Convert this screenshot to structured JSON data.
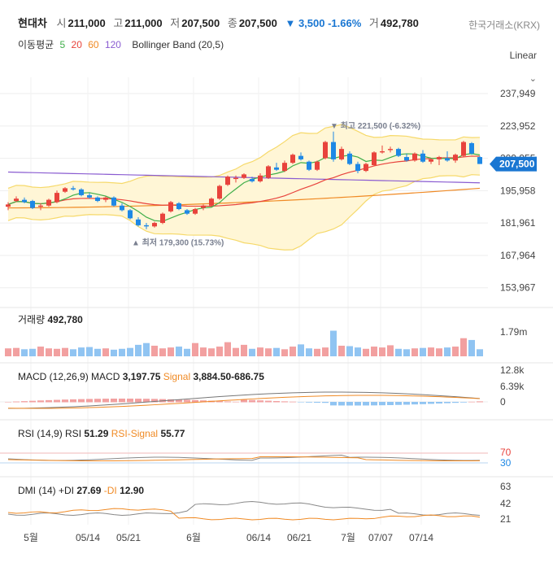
{
  "header": {
    "name": "현대차",
    "open_label": "시",
    "open": "211,000",
    "high_label": "고",
    "high": "211,000",
    "low_label": "저",
    "low": "207,500",
    "close_label": "종",
    "close": "207,500",
    "change_arrow": "▼",
    "change": "3,500 -1.66%",
    "volume_label": "거",
    "volume": "492,780",
    "exchange": "한국거래소(KRX)"
  },
  "indicators": {
    "ma_label": "이동평균",
    "ma": [
      {
        "period": "5",
        "color": "#3fae49"
      },
      {
        "period": "20",
        "color": "#e8433c"
      },
      {
        "period": "60",
        "color": "#f08a24"
      },
      {
        "period": "120",
        "color": "#8a5cd1"
      }
    ],
    "bb_label": "Bollinger Band (20,5)"
  },
  "scale_mode": "Linear",
  "chart_data": [
    {
      "type": "candlestick",
      "y_ticks": [
        "237,949",
        "223,952",
        "209,955",
        "195,958",
        "181,961",
        "167,964",
        "153,967"
      ],
      "ylim": [
        150000,
        245000
      ],
      "current_price": "207,500",
      "annotations": [
        {
          "text": "▼ 최고 221,500 (-6.32%)",
          "value": 221500
        },
        {
          "text": "▲ 최저 179,300 (15.73%)",
          "value": 179300
        }
      ],
      "ohlc": [
        [
          189000,
          191000,
          187500,
          190000
        ],
        [
          191500,
          193500,
          191000,
          192500
        ],
        [
          192000,
          193000,
          190500,
          191000
        ],
        [
          191500,
          192000,
          188000,
          188500
        ],
        [
          189000,
          190500,
          187500,
          189500
        ],
        [
          189500,
          192500,
          189000,
          192000
        ],
        [
          191000,
          196000,
          190500,
          195000
        ],
        [
          195500,
          197500,
          195000,
          197000
        ],
        [
          197000,
          198000,
          196000,
          196500
        ],
        [
          196500,
          197000,
          193500,
          194000
        ],
        [
          194000,
          195000,
          192500,
          193000
        ],
        [
          193000,
          193500,
          191000,
          191500
        ],
        [
          192000,
          193500,
          191000,
          193000
        ],
        [
          193000,
          193500,
          189000,
          189500
        ],
        [
          189500,
          190500,
          187000,
          187500
        ],
        [
          187500,
          188000,
          183500,
          184000
        ],
        [
          183500,
          184500,
          180500,
          181000
        ],
        [
          181000,
          182000,
          179300,
          180500
        ],
        [
          180500,
          182500,
          180000,
          182000
        ],
        [
          182000,
          186500,
          181500,
          186000
        ],
        [
          187000,
          191500,
          186500,
          191000
        ],
        [
          190500,
          191000,
          187500,
          188000
        ],
        [
          187500,
          188000,
          185500,
          186000
        ],
        [
          186000,
          188500,
          185500,
          188000
        ],
        [
          188500,
          190000,
          187500,
          189500
        ],
        [
          189500,
          193000,
          189000,
          192500
        ],
        [
          192500,
          198500,
          192000,
          198000
        ],
        [
          198500,
          202500,
          198000,
          202000
        ],
        [
          201000,
          202500,
          199500,
          201500
        ],
        [
          201500,
          203500,
          201000,
          203000
        ],
        [
          201000,
          202000,
          199500,
          200000
        ],
        [
          200000,
          203500,
          199500,
          202500
        ],
        [
          201500,
          207000,
          201000,
          206500
        ],
        [
          206000,
          208000,
          204500,
          205000
        ],
        [
          204500,
          209000,
          204000,
          208000
        ],
        [
          208000,
          212000,
          207500,
          211500
        ],
        [
          211000,
          212500,
          209000,
          209500
        ],
        [
          208500,
          209000,
          204500,
          205000
        ],
        [
          205000,
          209000,
          204500,
          208500
        ],
        [
          210000,
          217500,
          209500,
          217000
        ],
        [
          217000,
          221500,
          208500,
          209500
        ],
        [
          209500,
          215000,
          209000,
          214000
        ],
        [
          212000,
          213000,
          207000,
          207500
        ],
        [
          207500,
          208500,
          203500,
          204500
        ],
        [
          204500,
          208000,
          204000,
          207500
        ],
        [
          207000,
          213000,
          206500,
          212500
        ],
        [
          212500,
          215500,
          212000,
          213000
        ],
        [
          213500,
          215000,
          212500,
          214000
        ],
        [
          214000,
          214500,
          210500,
          211000
        ],
        [
          210500,
          212000,
          208500,
          209000
        ],
        [
          209000,
          212500,
          208500,
          212000
        ],
        [
          212000,
          213500,
          208000,
          208500
        ],
        [
          208500,
          210000,
          207500,
          209500
        ],
        [
          209500,
          211000,
          207000,
          210500
        ],
        [
          210000,
          213000,
          208500,
          209000
        ],
        [
          209000,
          212000,
          208000,
          211500
        ],
        [
          211000,
          217500,
          210500,
          217000
        ],
        [
          216500,
          217000,
          211500,
          212000
        ],
        [
          210500,
          211000,
          207500,
          207500
        ]
      ]
    },
    {
      "type": "bar",
      "title": "거래량",
      "value": "492,780",
      "y_ticks": [
        "1.79m"
      ],
      "values": [
        0.9,
        0.95,
        0.8,
        0.85,
        1.1,
        0.9,
        0.85,
        0.95,
        0.8,
        1.0,
        1.05,
        0.85,
        0.9,
        0.75,
        0.85,
        0.95,
        1.3,
        1.5,
        1.2,
        0.9,
        1.0,
        1.1,
        0.85,
        1.5,
        1.0,
        0.9,
        1.1,
        1.6,
        0.95,
        1.3,
        0.85,
        1.0,
        0.9,
        0.95,
        0.8,
        1.1,
        1.35,
        0.9,
        0.85,
        1.0,
        2.9,
        1.2,
        1.15,
        1.0,
        0.85,
        1.1,
        1.0,
        1.25,
        0.85,
        0.8,
        0.9,
        0.95,
        1.0,
        0.9,
        1.0,
        1.1,
        2.05,
        1.85,
        0.8
      ],
      "ylim": [
        0,
        3.5
      ]
    },
    {
      "type": "line",
      "title": "MACD (12,26,9)",
      "macd_label": "MACD",
      "macd_value": "3,197.75",
      "signal_label": "Signal",
      "signal_value": "3,884.50",
      "hist_value": "-686.75",
      "y_ticks": [
        "12.8k",
        "6.39k",
        "0"
      ]
    },
    {
      "type": "line",
      "title": "RSI (14,9)",
      "rsi_label": "RSI",
      "rsi_value": "51.29",
      "signal_label": "RSI-Signal",
      "signal_value": "55.77",
      "y_ticks": [
        "70",
        "30"
      ]
    },
    {
      "type": "line",
      "title": "DMI (14)",
      "pdi_label": "+DI",
      "pdi_value": "27.69",
      "mdi_label": "-DI",
      "mdi_value": "12.90",
      "y_ticks": [
        "63",
        "42",
        "21"
      ]
    }
  ],
  "x_ticks": [
    {
      "label": "5월",
      "index": 2
    },
    {
      "label": "05/14",
      "index": 9
    },
    {
      "label": "05/21",
      "index": 14
    },
    {
      "label": "6월",
      "index": 22
    },
    {
      "label": "06/14",
      "index": 30
    },
    {
      "label": "06/21",
      "index": 35
    },
    {
      "label": "7월",
      "index": 41
    },
    {
      "label": "07/07",
      "index": 45
    },
    {
      "label": "07/14",
      "index": 50
    }
  ],
  "colors": {
    "up": "#e8433c",
    "down": "#1e88e5",
    "bb_fill": "#fff6d6",
    "bb_line": "#f6d96a",
    "accent": "#1976d2"
  }
}
